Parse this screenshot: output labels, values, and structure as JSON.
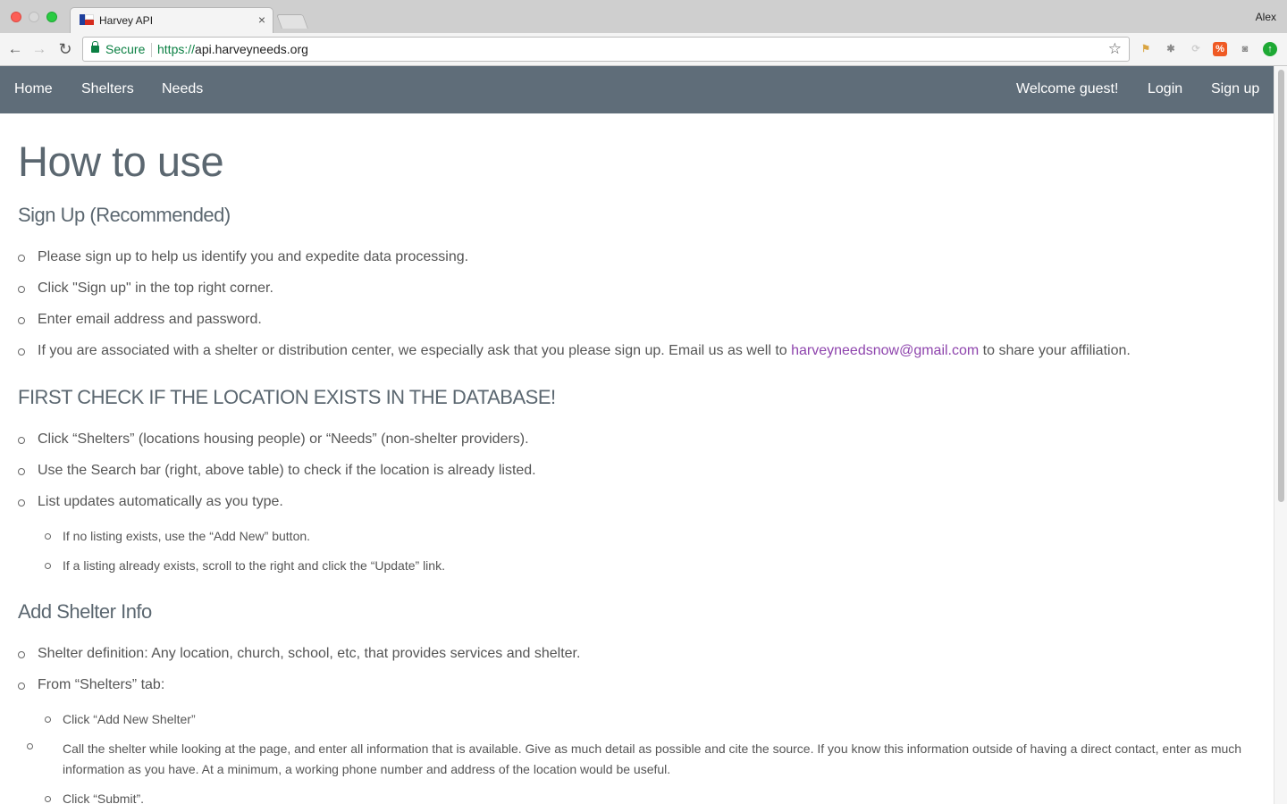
{
  "browser": {
    "tab_title": "Harvey API",
    "tab_close": "×",
    "profile_name": "Alex",
    "secure_label": "Secure",
    "url_scheme": "https://",
    "url_host": "api.harveyneeds.org"
  },
  "navbar": {
    "left": [
      "Home",
      "Shelters",
      "Needs"
    ],
    "welcome": "Welcome guest!",
    "login": "Login",
    "signup": "Sign up",
    "bg_color": "#5f6d79"
  },
  "page": {
    "title": "How to use",
    "sections": [
      {
        "heading": "Sign Up (Recommended)",
        "items": [
          "Please sign up to help us identify you and expedite data processing.",
          "Click \"Sign up\" in the top right corner.",
          "Enter email address and password."
        ],
        "affiliation_item": {
          "before": "If you are associated with a shelter or distribution center, we especially ask that you please sign up. Email us as well to ",
          "email": "harveyneedsnow@gmail.com",
          "after": " to share your affiliation."
        }
      },
      {
        "heading": "FIRST CHECK IF THE LOCATION EXISTS IN THE DATABASE!",
        "items": [
          "Click “Shelters” (locations housing people) or “Needs” (non-shelter providers).",
          "Use the Search bar (right, above table) to check if the location is already listed.",
          "List updates automatically as you type."
        ],
        "subitems": [
          "If no listing exists, use the “Add New” button.",
          "If a listing already exists, scroll to the right and click the “Update” link."
        ]
      },
      {
        "heading": "Add Shelter Info",
        "items": [
          "Shelter definition: Any location, church, school, etc, that provides services and shelter.",
          "From “Shelters” tab:"
        ],
        "subitems": [
          "Click “Add New Shelter”",
          "Call the shelter while looking at the page, and enter all information that is available. Give as much detail as possible and cite the source. If you know this information outside of having a direct contact, enter as much information as you have. At a minimum, a working phone number and address of the location would be useful.",
          "Click “Submit”."
        ]
      }
    ]
  }
}
